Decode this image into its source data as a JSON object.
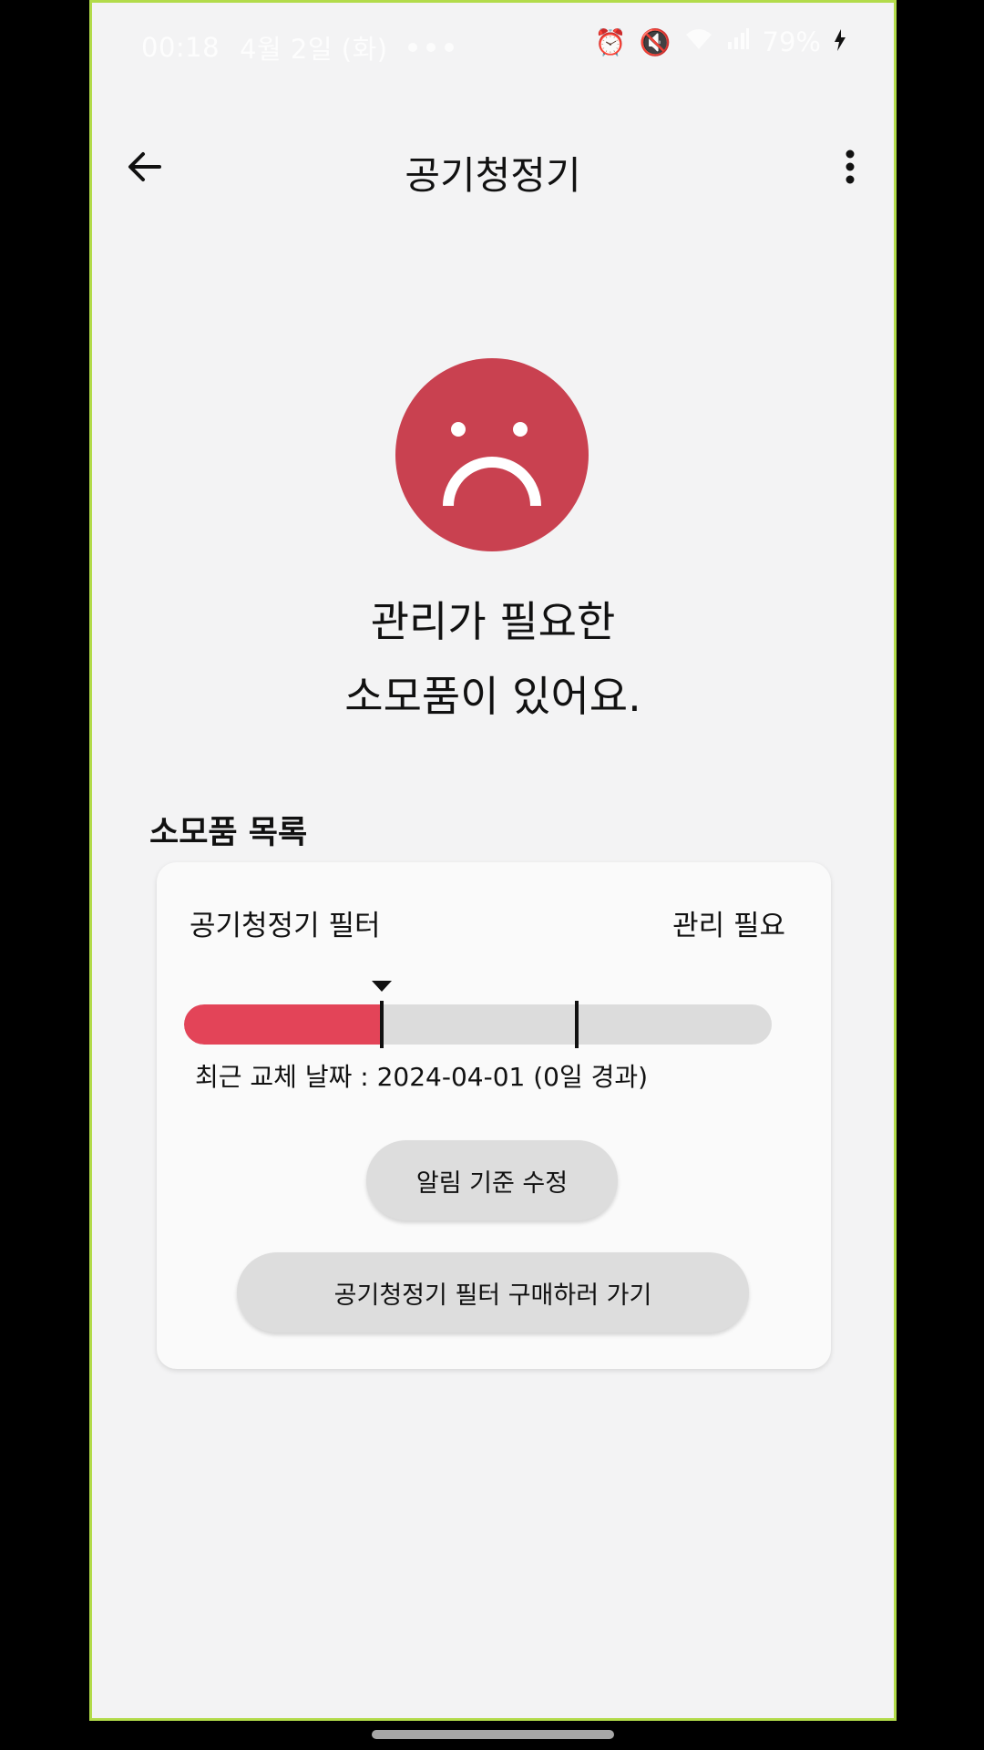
{
  "status_bar": {
    "time": "00:18",
    "date": "4월 2일 (화)",
    "battery": "79%",
    "icons": [
      "alarm-icon",
      "mute-icon",
      "wifi-icon",
      "signal-icon",
      "charging-icon"
    ]
  },
  "app_bar": {
    "title": "공기청정기",
    "back_icon": "arrow-left-icon",
    "more_icon": "more-vert-icon"
  },
  "status_face": {
    "icon": "sad-face-icon",
    "color": "#c94150"
  },
  "headline": {
    "line1": "관리가 필요한",
    "line2": "소모품이 있어요."
  },
  "section": {
    "title": "소모품 목록"
  },
  "consumables": [
    {
      "name": "공기청정기 필터",
      "status": "관리 필요",
      "progress_fraction": 0.34,
      "threshold_fractions": [
        0.34,
        0.67
      ],
      "last_replaced": "최근 교체 날짜 : 2024-04-01 (0일 경과)",
      "alert_button_label": "알림 기준 수정",
      "buy_button_label": "공기청정기 필터 구매하러 가기",
      "fill_color": "#e34458"
    }
  ]
}
